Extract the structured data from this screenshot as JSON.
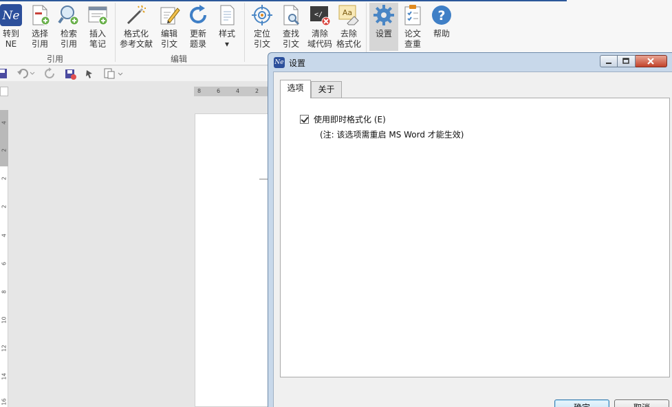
{
  "ribbon": {
    "buttons": [
      {
        "line1": "转到",
        "line2": "NE"
      },
      {
        "line1": "选择",
        "line2": "引用"
      },
      {
        "line1": "检索",
        "line2": "引用"
      },
      {
        "line1": "插入",
        "line2": "笔记"
      },
      {
        "line1": "格式化",
        "line2": "参考文献"
      },
      {
        "line1": "编辑",
        "line2": "引文"
      },
      {
        "line1": "更新",
        "line2": "题录"
      },
      {
        "line1": "样式",
        "line2": "▾"
      },
      {
        "line1": "定位",
        "line2": "引文"
      },
      {
        "line1": "查找",
        "line2": "引文"
      },
      {
        "line1": "清除",
        "line2": "域代码"
      },
      {
        "line1": "去除",
        "line2": "格式化"
      },
      {
        "line1": "设置",
        "line2": ""
      },
      {
        "line1": "论文",
        "line2": "查重"
      },
      {
        "line1": "帮助",
        "line2": ""
      }
    ],
    "groups": {
      "cite": "引用",
      "edit": "编辑"
    },
    "icon_texts": {
      "ne": "Ne",
      "help": "?",
      "clear": "</",
      "format": "Aa"
    }
  },
  "ruler": {
    "horizontal": [
      "8",
      "6",
      "4",
      "2"
    ],
    "vertical": [
      "4",
      "2",
      "2",
      "2",
      "4",
      "6",
      "8",
      "10",
      "12",
      "14",
      "16"
    ]
  },
  "dialog": {
    "icon_text": "Ne",
    "title": "设置",
    "tabs": {
      "options": "选项",
      "about": "关于"
    },
    "option": {
      "label": "使用即时格式化 (E)",
      "checked": true,
      "note": "(注: 该选项需重启 MS Word 才能生效)"
    },
    "ok": "确定",
    "cancel": "取消"
  },
  "colors": {
    "accent": "#2b579a",
    "dialog_frame": "#c8d8ea",
    "ok_border": "#3c7fb1"
  }
}
